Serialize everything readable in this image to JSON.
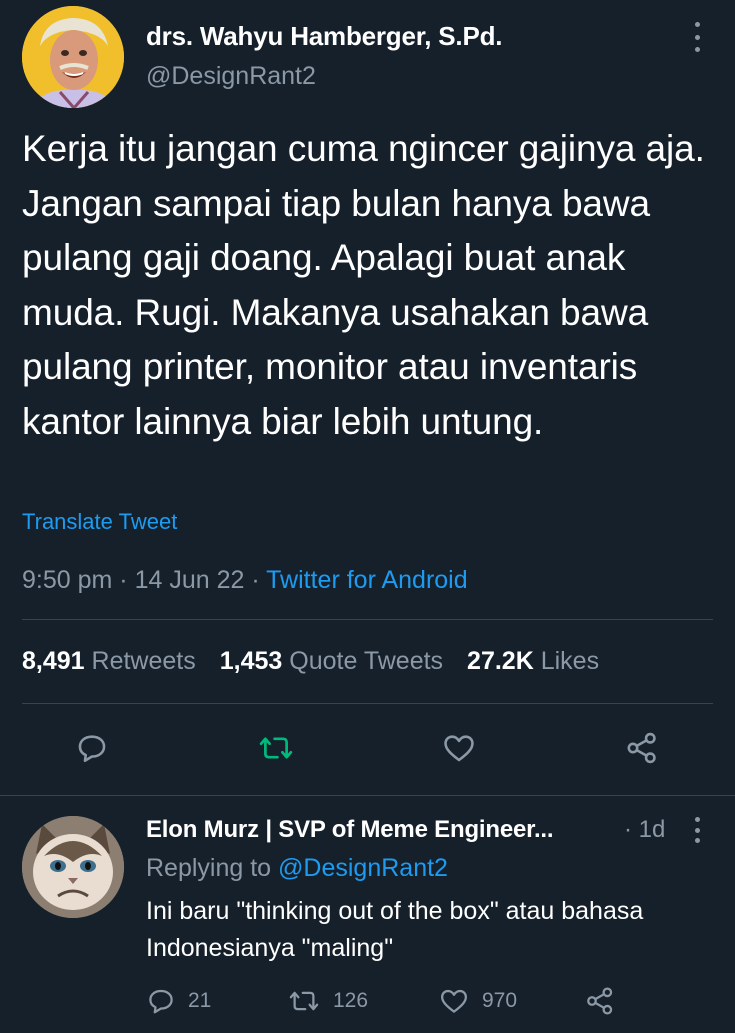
{
  "tweet": {
    "author_name": "drs. Wahyu Hamberger, S.Pd.",
    "author_handle": "@DesignRant2",
    "text": "Kerja itu jangan cuma ngincer gajinya aja. Jangan sampai tiap bulan hanya bawa pulang gaji doang. Apalagi buat anak muda. Rugi. Makanya usahakan bawa pulang printer, monitor atau inventaris kantor lainnya biar lebih untung.",
    "translate_label": "Translate Tweet",
    "time": "9:50 pm",
    "separator": " · ",
    "date": "14 Jun 22",
    "source": "Twitter for Android",
    "stats": {
      "retweets_count": "8,491",
      "retweets_label": "Retweets",
      "quotes_count": "1,453",
      "quotes_label": "Quote Tweets",
      "likes_count": "27.2K",
      "likes_label": "Likes"
    },
    "icons": [
      "reply-icon",
      "retweet-icon",
      "like-icon",
      "share-icon",
      "more-icon"
    ],
    "colors": {
      "background": "#15202b",
      "accent": "#1d9bf0",
      "retweet_active": "#00ba7c",
      "muted": "#8b98a5",
      "divider": "#38444d"
    }
  },
  "reply": {
    "author_name": "Elon Murz | SVP of Meme Engineer...",
    "time": "· 1d",
    "replying_label": "Replying to",
    "replying_to": "@DesignRant2",
    "text": "Ini baru \"thinking out of the box\" atau bahasa Indonesianya \"maling\"",
    "reply_count": "21",
    "retweet_count": "126",
    "like_count": "970"
  }
}
